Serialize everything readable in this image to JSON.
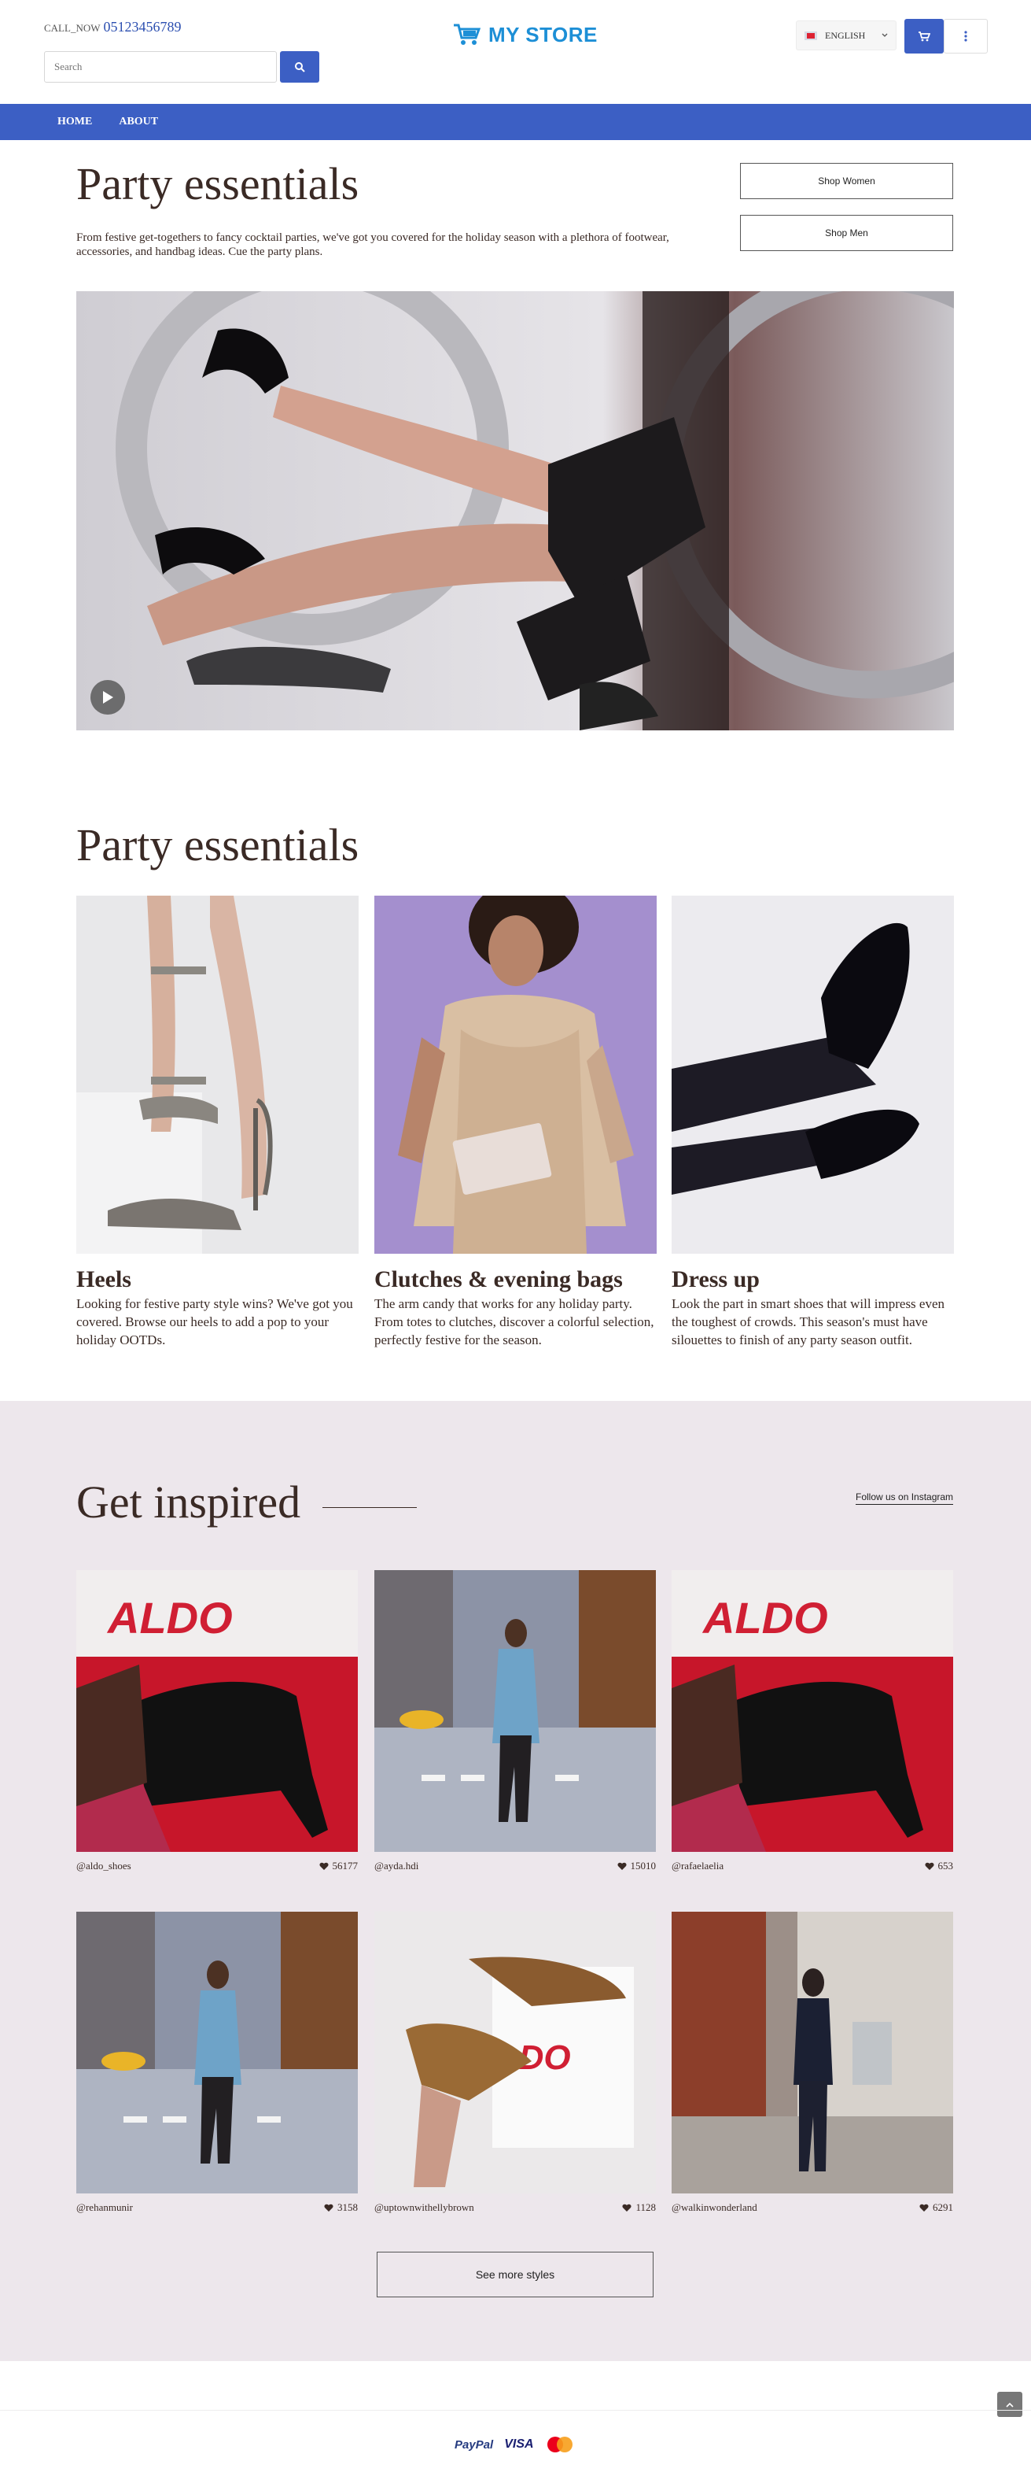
{
  "header": {
    "call_label": "CALL_NOW",
    "phone": "05123456789",
    "search_placeholder": "Search",
    "logo_text": "MY STORE",
    "language": "ENGLISH"
  },
  "nav": {
    "items": [
      "HOME",
      "ABOUT"
    ]
  },
  "hero": {
    "title": "Party essentials",
    "description": "From festive get-togethers to fancy cocktail parties, we've got you covered for the holiday season with a plethora of footwear, accessories, and handbag ideas. Cue the party plans.",
    "shop_women": "Shop Women",
    "shop_men": "Shop Men"
  },
  "categories": {
    "title": "Party essentials",
    "items": [
      {
        "name": "Heels",
        "description": "Looking for festive party style wins? We've got you covered. Browse our heels to add a pop to your holiday OOTDs."
      },
      {
        "name": "Clutches & evening bags",
        "description": "The arm candy that works for any holiday party. From totes to clutches, discover a colorful selection, perfectly festive for the season."
      },
      {
        "name": "Dress up",
        "description": "Look the part in smart shoes that will impress even the toughest of crowds. This season's must have silouettes to finish of any party season outfit."
      }
    ]
  },
  "inspired": {
    "title": "Get inspired",
    "follow_label": "Follow us on Instagram",
    "posts": [
      {
        "user": "@aldo_shoes",
        "likes": "56177"
      },
      {
        "user": "@ayda.hdi",
        "likes": "15010"
      },
      {
        "user": "@rafaelaelia",
        "likes": "653"
      },
      {
        "user": "@rehanmunir",
        "likes": "3158"
      },
      {
        "user": "@uptownwithellybrown",
        "likes": "1128"
      },
      {
        "user": "@walkinwonderland",
        "likes": "6291"
      }
    ],
    "see_more": "See more styles",
    "brand_text": "ALDO"
  },
  "footer": {
    "paypal": "PayPal",
    "visa": "VISA"
  },
  "colors": {
    "accent": "#3c5fc4",
    "logo": "#1d8fd6",
    "inspired_bg": "#ede7ec",
    "text": "#3a2a25"
  }
}
